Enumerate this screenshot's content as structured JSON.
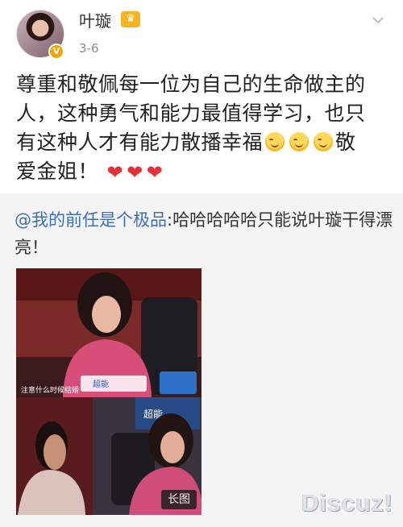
{
  "post": {
    "username": "叶璇",
    "date": "3-6",
    "text_line1": "尊重和敬佩每一位为自己的生命做主的",
    "text_line2": "人，这种勇气和能力最值得学习，也只",
    "text_line3": "有这种人才有能力散播幸福",
    "text_line3_end": "敬",
    "text_line4": "爱金姐！",
    "icons": [
      "avatar",
      "verified-badge-icon",
      "crown-icon",
      "chevron-down-icon",
      "smile-emoji-icon",
      "heart-icon"
    ]
  },
  "repost": {
    "mention": "@我的前任是个极品",
    "text": ":哈哈哈哈哈只能说叶璇干得漂亮！",
    "image_caption": "注意什么时候结婚",
    "image_brand1": "超能",
    "image_brand2": "超能",
    "long_image_label": "长图"
  },
  "watermark": "Discuz!",
  "colors": {
    "accent_blue": "#3c6fb5",
    "heart_red": "#e53038",
    "repost_bg": "#f4f4f4"
  }
}
